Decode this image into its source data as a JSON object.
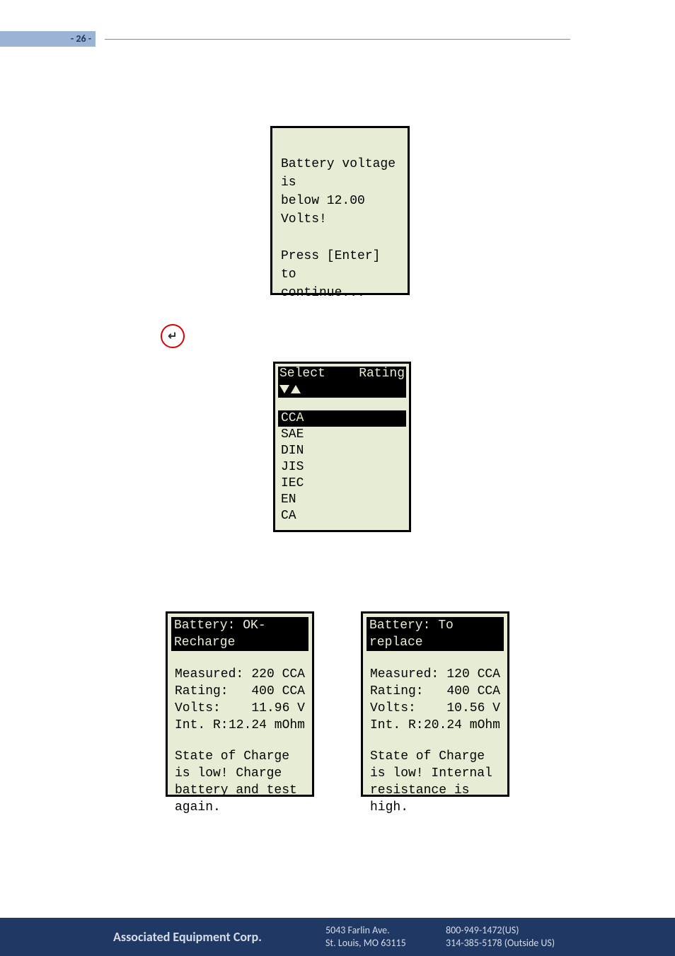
{
  "page_number": "- 26 -",
  "lcd1": {
    "line1": "Battery voltage is",
    "line2": "below 12.00 Volts!",
    "line3": "Press [Enter] to",
    "line4": "continue..."
  },
  "enter_button": {
    "icon": "↵"
  },
  "lcd2": {
    "header_left": "Select",
    "header_right": "Rating",
    "items": [
      "CCA",
      "SAE",
      "DIN",
      "JIS",
      "IEC",
      "EN",
      "CA"
    ],
    "selected_index": 0
  },
  "lcd3": {
    "title": "Battery: OK-Recharge",
    "rows": [
      {
        "label": "Measured:",
        "value": "220 CCA"
      },
      {
        "label": "Rating:",
        "value": "400 CCA"
      },
      {
        "label": "Volts:",
        "value": "11.96 V"
      },
      {
        "label": "Int. R:",
        "value": "12.24 mOhm"
      }
    ],
    "message": "State of Charge is low! Charge battery and test again."
  },
  "lcd4": {
    "title": "Battery: To replace",
    "rows": [
      {
        "label": "Measured:",
        "value": "120 CCA"
      },
      {
        "label": "Rating:",
        "value": "400 CCA"
      },
      {
        "label": "Volts:",
        "value": "10.56 V"
      },
      {
        "label": "Int. R:",
        "value": "20.24 mOhm"
      }
    ],
    "message": "State of Charge is low! Internal resistance is high."
  },
  "footer": {
    "company": "Associated Equipment Corp.",
    "addr1": "5043 Farlin Ave.",
    "addr2": "St. Louis, MO 63115",
    "phone1": "800-949-1472(US)",
    "phone2": "314-385-5178 (Outside US)"
  }
}
